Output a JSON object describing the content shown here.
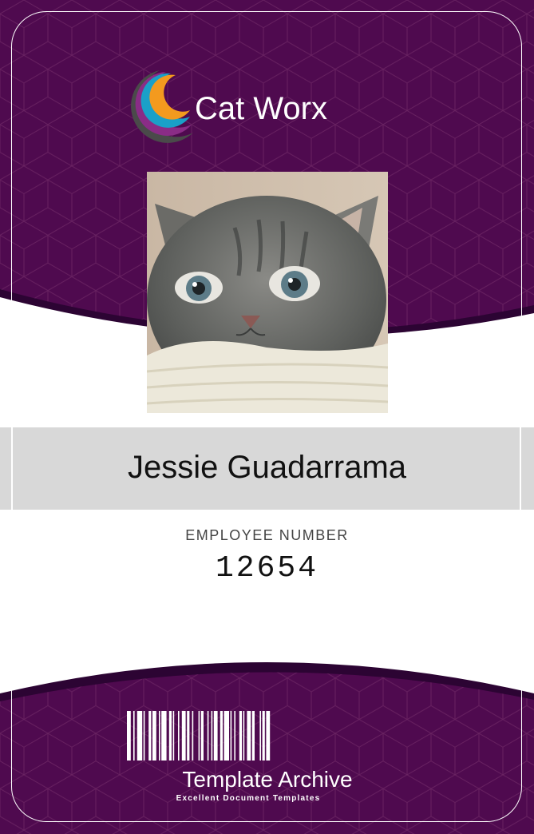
{
  "company": {
    "name": "Cat Worx"
  },
  "employee": {
    "name": "Jessie Guadarrama",
    "number_label": "EMPLOYEE NUMBER",
    "number": "12654"
  },
  "brand": {
    "name": "Template Archive",
    "tagline": "Excellent Document Templates"
  },
  "icons": {
    "logo": "crescent-rings-icon",
    "barcode": "barcode-icon",
    "photo": "kitten-photo"
  },
  "colors": {
    "primary": "#4f0a4f",
    "dark": "#2c0433",
    "pattern_line": "#7d3670",
    "name_bar": "#d8d8d8",
    "logo_orange": "#f39a1e",
    "logo_blue": "#1aa0c8",
    "logo_purple": "#8a2c86",
    "logo_gray": "#4a4a4a"
  }
}
